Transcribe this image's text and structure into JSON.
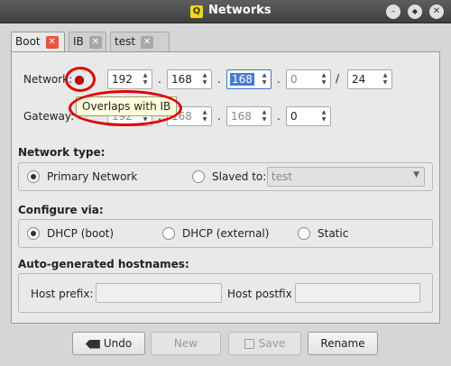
{
  "window": {
    "title": "Networks",
    "app_icon_glyph": "Q",
    "controls": {
      "minimize": "–",
      "maximize": "◆",
      "close": "✕"
    }
  },
  "tabs": [
    {
      "label": "Boot",
      "active": true,
      "close_icon": "✕"
    },
    {
      "label": "IB",
      "active": false,
      "close_icon": "✕"
    },
    {
      "label": "test",
      "active": false,
      "close_icon": "✕"
    }
  ],
  "network": {
    "label": "Network:",
    "octets": [
      "192",
      "168",
      "168",
      "0"
    ],
    "prefix": "24",
    "dot": ".",
    "slash": "/",
    "conflict_indicator": "red-dot"
  },
  "gateway": {
    "label": "Gateway:",
    "octets": [
      "192",
      "168",
      "168",
      "0"
    ]
  },
  "tooltip": {
    "text": "Overlaps with IB"
  },
  "network_type": {
    "heading": "Network type:",
    "primary_label": "Primary Network",
    "primary_selected": true,
    "slaved_label": "Slaved to:",
    "slaved_selected": false,
    "slaved_value": "test"
  },
  "configure": {
    "heading": "Configure via:",
    "options": [
      {
        "label": "DHCP (boot)",
        "selected": true
      },
      {
        "label": "DHCP (external)",
        "selected": false
      },
      {
        "label": "Static",
        "selected": false
      }
    ]
  },
  "hostnames": {
    "heading": "Auto-generated hostnames:",
    "prefix_label": "Host prefix:",
    "prefix_value": "",
    "postfix_label": "Host postfix",
    "postfix_value": ""
  },
  "buttons": {
    "undo": "Undo",
    "new": "New",
    "save": "Save",
    "rename": "Rename"
  },
  "colors": {
    "accent": "#4a7ad1",
    "tab_close": "#e8553d",
    "annotation": "#e00000"
  }
}
